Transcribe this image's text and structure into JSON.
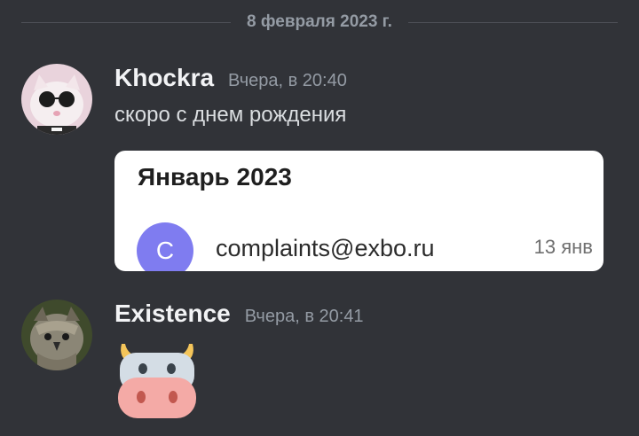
{
  "divider": {
    "date": "8 февраля 2023 г."
  },
  "messages": [
    {
      "username": "Khockra",
      "timestamp": "Вчера, в 20:40",
      "text": "скоро с днем рождения",
      "embed": {
        "title": "Январь 2023",
        "avatar_letter": "C",
        "email": "complaints@exbo.ru",
        "date": "13 янв"
      }
    },
    {
      "username": "Existence",
      "timestamp": "Вчера, в 20:41",
      "sticker": "cow-face-emoji"
    }
  ],
  "colors": {
    "background": "#313338",
    "username": "#f2f3f5",
    "timestamp": "#949ba4",
    "embed_background": "#ffffff",
    "embed_avatar": "#7f7cf0"
  }
}
